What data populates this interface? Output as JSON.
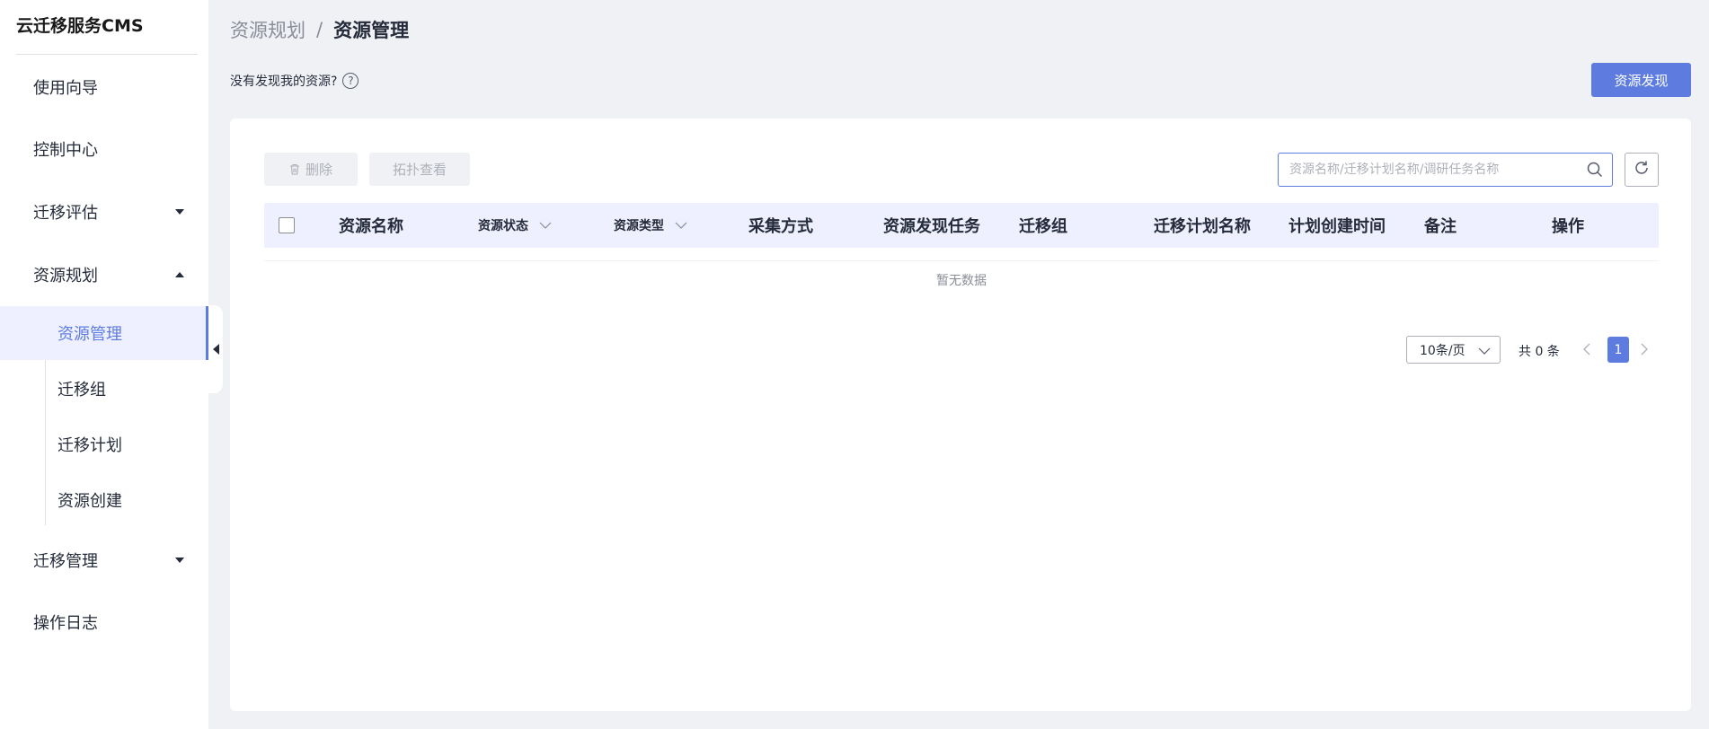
{
  "sidebar": {
    "brand": "云迁移服务CMS",
    "items": [
      {
        "label": "使用向导"
      },
      {
        "label": "控制中心"
      },
      {
        "label": "迁移评估"
      },
      {
        "label": "资源规划"
      },
      {
        "label": "迁移管理"
      },
      {
        "label": "操作日志"
      }
    ],
    "sub_items": [
      {
        "label": "资源管理",
        "active": true
      },
      {
        "label": "迁移组"
      },
      {
        "label": "迁移计划"
      },
      {
        "label": "资源创建"
      }
    ]
  },
  "breadcrumb": {
    "parent": "资源规划",
    "separator": "/",
    "current": "资源管理"
  },
  "hint": {
    "text": "没有发现我的资源?",
    "help_icon": "question-circle-icon"
  },
  "header": {
    "discover_button": "资源发现"
  },
  "toolbar": {
    "delete_label": "删除",
    "topology_label": "拓扑查看",
    "search_placeholder": "资源名称/迁移计划名称/调研任务名称",
    "search_value": ""
  },
  "table": {
    "columns": [
      {
        "label": "资源名称"
      },
      {
        "label": "资源状态",
        "filter": true
      },
      {
        "label": "资源类型",
        "filter": true
      },
      {
        "label": "采集方式"
      },
      {
        "label": "资源发现任务"
      },
      {
        "label": "迁移组"
      },
      {
        "label": "迁移计划名称"
      },
      {
        "label": "计划创建时间"
      },
      {
        "label": "备注"
      },
      {
        "label": "操作"
      }
    ],
    "empty_text": "暂无数据"
  },
  "pagination": {
    "page_size": "10条/页",
    "total": "共 0 条",
    "current_page": "1"
  },
  "colors": {
    "accent": "#5e7ce0",
    "active_bg": "#eef0ff",
    "page_bg": "#f0f1f5"
  }
}
